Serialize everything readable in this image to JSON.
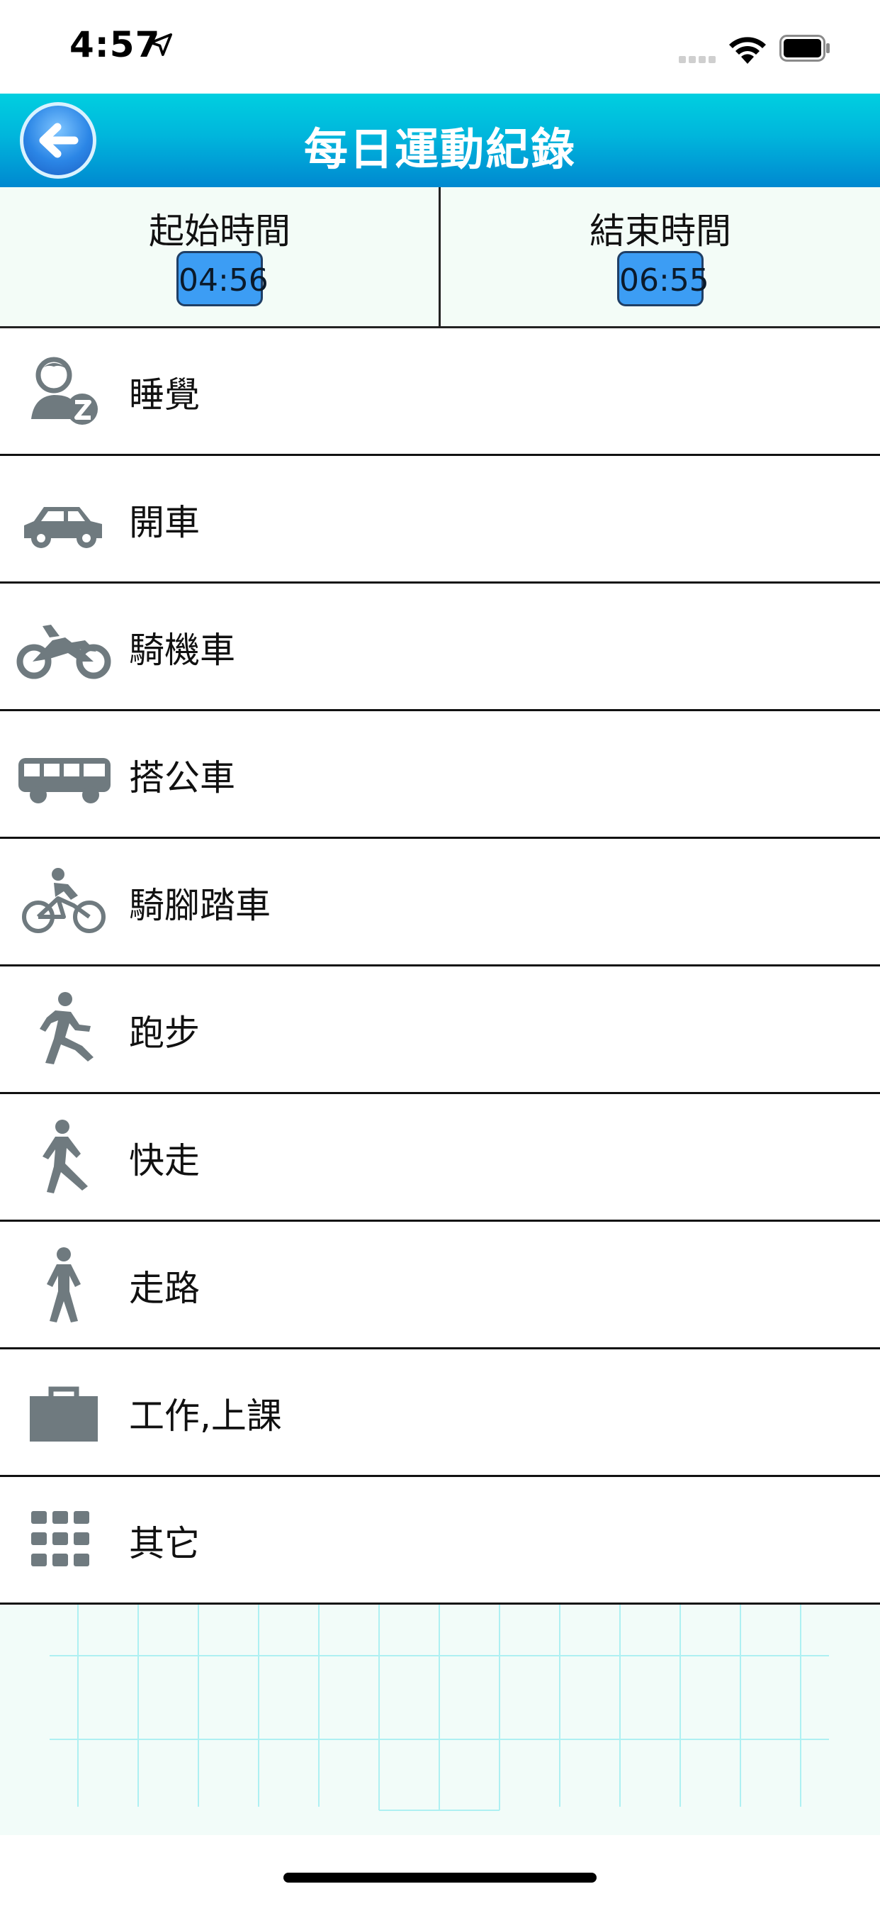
{
  "status_bar": {
    "time": "4:57"
  },
  "nav": {
    "title": "每日運動紀錄",
    "back_icon": "back-arrow-icon"
  },
  "time_range": {
    "start_label": "起始時間",
    "start_value": "04:56",
    "end_label": "結束時間",
    "end_value": "06:55"
  },
  "activities": [
    {
      "label": "睡覺",
      "icon": "sleep-icon"
    },
    {
      "label": "開車",
      "icon": "car-icon"
    },
    {
      "label": "騎機車",
      "icon": "motorcycle-icon"
    },
    {
      "label": "搭公車",
      "icon": "bus-icon"
    },
    {
      "label": "騎腳踏車",
      "icon": "bicycle-icon"
    },
    {
      "label": "跑步",
      "icon": "running-icon"
    },
    {
      "label": "快走",
      "icon": "brisk-walk-icon"
    },
    {
      "label": "走路",
      "icon": "walking-icon"
    },
    {
      "label": "工作,上課",
      "icon": "briefcase-icon"
    },
    {
      "label": "其它",
      "icon": "grid-icon"
    }
  ],
  "colors": {
    "nav_gradient_top": "#00cfe0",
    "nav_gradient_bottom": "#0088d0",
    "time_badge": "#3c9df4",
    "icon_gray": "#6f7a7f",
    "grid_line": "#aef0f2"
  }
}
